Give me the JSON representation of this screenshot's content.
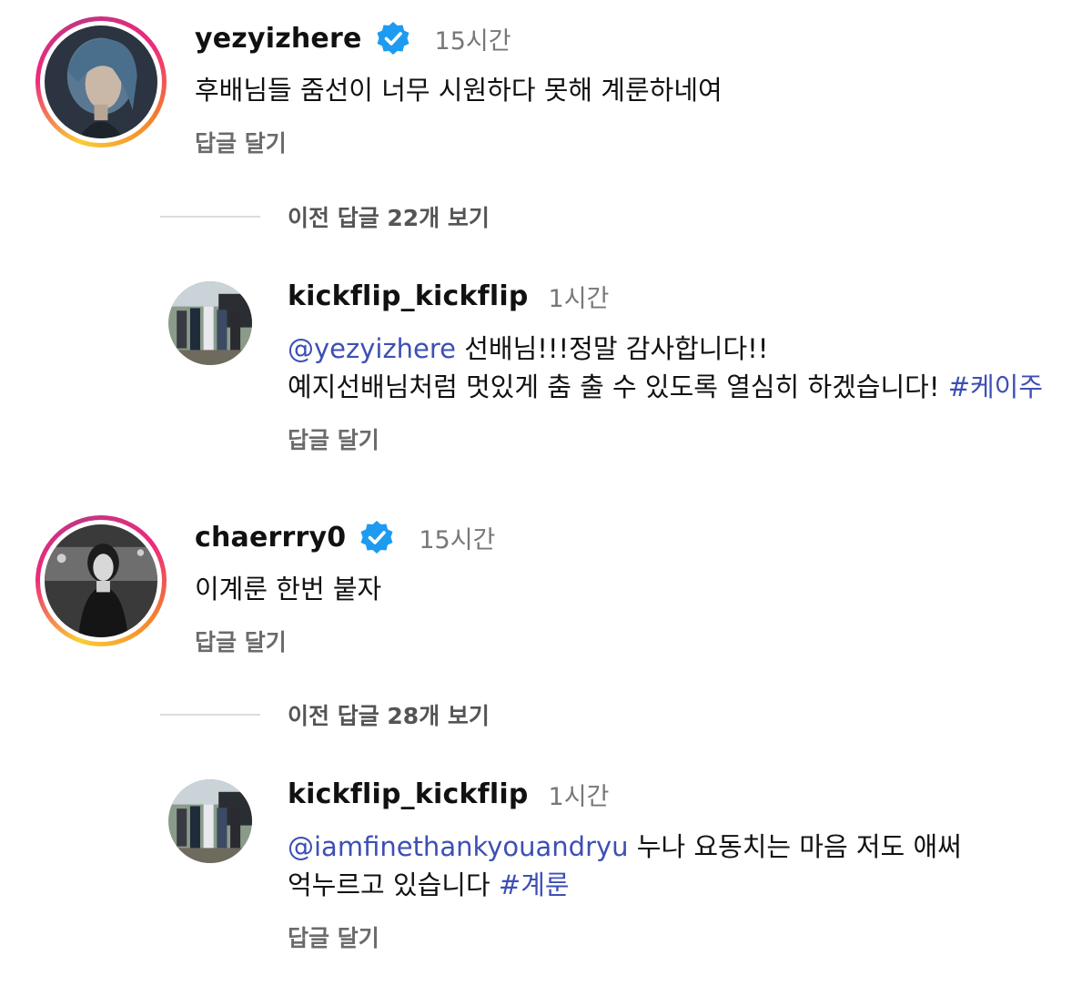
{
  "threads": [
    {
      "comment": {
        "username": "yezyizhere",
        "verified_icon": "verified-badge-icon",
        "time": "15시간",
        "text": "후배님들 줌선이 너무 시원하다 못해 계룬하네여",
        "reply_label": "답글 달기"
      },
      "view_previous": "이전 답글 22개 보기",
      "reply": {
        "username": "kickflip_kickflip",
        "time": "1시간",
        "mention": "@yezyizhere",
        "line1_rest": " 선배님!!!정말 감사합니다!!",
        "line2": "예지선배님처럼 멋있게 춤 출 수 있도록 열심히 하겠습니다! ",
        "hashtag": "#케이주",
        "reply_label": "답글 달기"
      }
    },
    {
      "comment": {
        "username": "chaerrry0",
        "verified_icon": "verified-badge-icon",
        "time": "15시간",
        "text": "이계룬 한번 붙자",
        "reply_label": "답글 달기"
      },
      "view_previous": "이전 답글 28개 보기",
      "reply": {
        "username": "kickflip_kickflip",
        "time": "1시간",
        "mention": "@iamfinethankyouandryu",
        "line1_rest": " 누나 요동치는 마음 저도 애써",
        "line2": "억누르고 있습니다 ",
        "hashtag": "#계룬",
        "reply_label": "답글 달기"
      }
    }
  ],
  "colors": {
    "link": "#3d4fb5",
    "verified": "#1d9bf0",
    "muted": "#6b6b6b"
  }
}
